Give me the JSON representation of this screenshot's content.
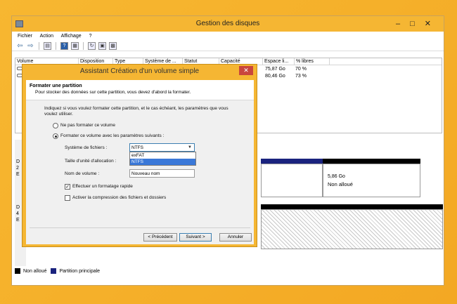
{
  "window": {
    "title": "Gestion des disques"
  },
  "menu": [
    "Fichier",
    "Action",
    "Affichage",
    "?"
  ],
  "list": {
    "columns": [
      "Volume",
      "Disposition",
      "Type",
      "Système de ...",
      "Statut",
      "Capacité",
      "Espace li...",
      "% libres"
    ],
    "rows": [
      {
        "free": "75,87 Go",
        "pct": "70 %"
      },
      {
        "free": "80,46 Go",
        "pct": "73 %"
      }
    ]
  },
  "disk": {
    "left_labels": [
      "D",
      "2",
      "E",
      "D",
      "4",
      "E"
    ],
    "unalloc_size": "5,86 Go",
    "unalloc_label": "Non alloué"
  },
  "legend": {
    "unallocated": "Non alloué",
    "primary": "Partition principale"
  },
  "colors": {
    "unallocated": "#000000",
    "primary": "#1a237e"
  },
  "dialog": {
    "title": "Assistant Création d'un volume simple",
    "close": "✕",
    "heading": "Formater une partition",
    "subheading": "Pour stocker des données sur cette partition, vous devez d'abord la formater.",
    "intro_line1": "Indiquez si vous voulez formater cette partition, et le cas échéant, les paramètres que vous",
    "intro_line2": "voulez utiliser.",
    "radio_noformat": "Ne pas formater ce volume",
    "radio_format": "Formater ce volume avec les paramètres suivants :",
    "fs_label": "Système de fichiers :",
    "fs_value": "NTFS",
    "fs_options": [
      "exFAT",
      "NTFS"
    ],
    "alloc_label": "Taille d'unité d'allocation :",
    "volname_label": "Nom de volume :",
    "volname_value": "Nouveau nom",
    "quick_format": "Effectuer un formatage rapide",
    "compression": "Activer la compression des fichiers et dossiers",
    "btn_prev": "< Précédent",
    "btn_next": "Suivant >",
    "btn_cancel": "Annuler"
  }
}
